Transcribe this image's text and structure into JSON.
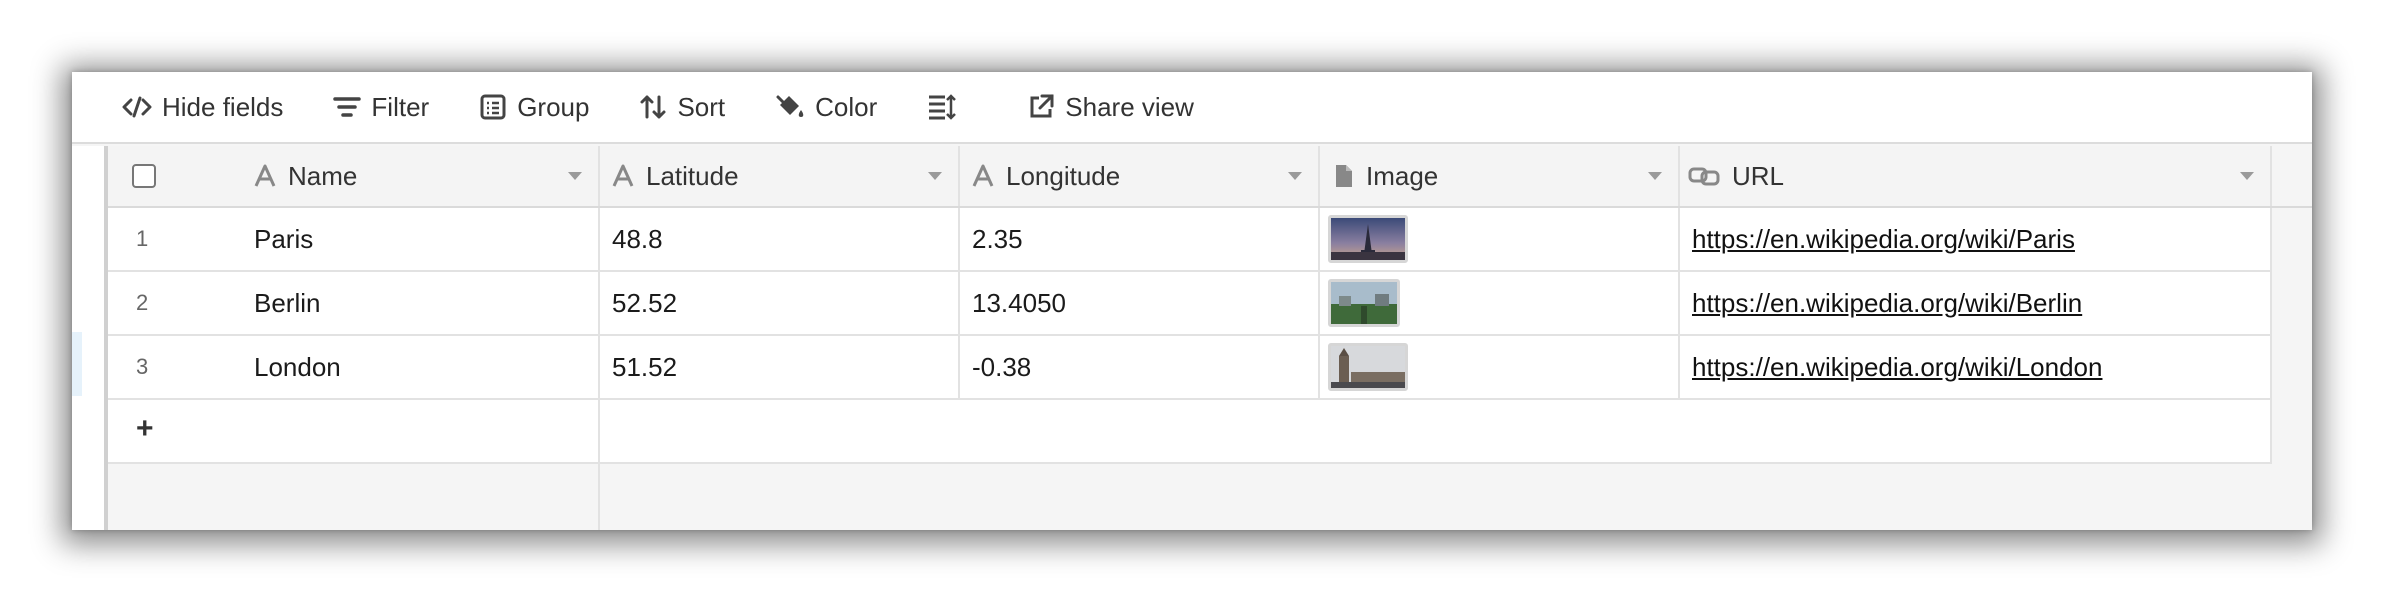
{
  "toolbar": {
    "hide_fields": "Hide fields",
    "filter": "Filter",
    "group": "Group",
    "sort": "Sort",
    "color": "Color",
    "row_height_icon": "row-height-icon",
    "share_view": "Share view"
  },
  "columns": [
    {
      "label": "Name",
      "icon": "text-field-icon"
    },
    {
      "label": "Latitude",
      "icon": "text-field-icon"
    },
    {
      "label": "Longitude",
      "icon": "text-field-icon"
    },
    {
      "label": "Image",
      "icon": "attachment-field-icon"
    },
    {
      "label": "URL",
      "icon": "link-field-icon"
    }
  ],
  "rows": [
    {
      "num": "1",
      "name": "Paris",
      "lat": "48.8",
      "lon": "2.35",
      "image": "eiffel-tower-thumbnail",
      "url": "https://en.wikipedia.org/wiki/Paris"
    },
    {
      "num": "2",
      "name": "Berlin",
      "lat": "52.52",
      "lon": "13.4050",
      "image": "berlin-thumbnail",
      "url": "https://en.wikipedia.org/wiki/Berlin"
    },
    {
      "num": "3",
      "name": "London",
      "lat": "51.52",
      "lon": "-0.38",
      "image": "big-ben-thumbnail",
      "url": "https://en.wikipedia.org/wiki/London"
    }
  ],
  "add_row": "+",
  "colors": {
    "border": "#e2e2e2",
    "header_bg": "#f4f4f4",
    "grid_bg": "#f5f5f5"
  }
}
